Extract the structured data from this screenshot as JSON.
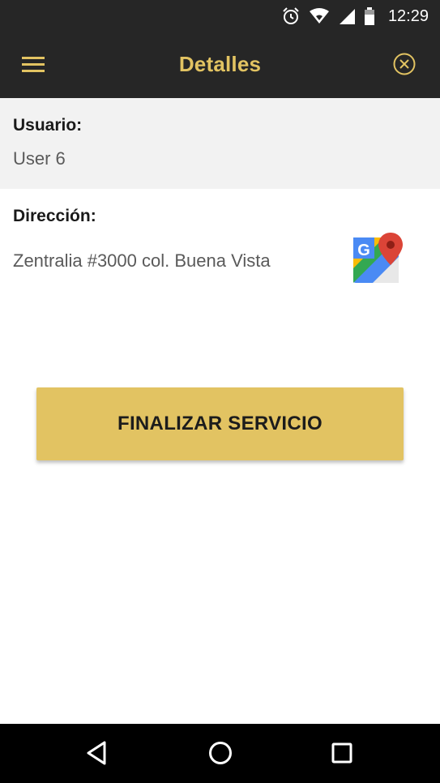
{
  "status_bar": {
    "time": "12:29",
    "icons": [
      "alarm-icon",
      "wifi-icon",
      "cell-signal-icon",
      "battery-icon"
    ]
  },
  "app_bar": {
    "title": "Detalles",
    "menu_icon": "hamburger-menu-icon",
    "close_icon": "close-circle-icon"
  },
  "user": {
    "label": "Usuario:",
    "value": "User 6"
  },
  "address": {
    "label": "Dirección:",
    "value": "Zentralia #3000 col. Buena Vista",
    "map_icon": "google-maps-icon"
  },
  "actions": {
    "finish_label": "FINALIZAR SERVICIO"
  },
  "nav_bar": {
    "icons": [
      "back-icon",
      "home-icon",
      "recents-icon"
    ]
  },
  "colors": {
    "accent": "#e2c362",
    "app_bar": "#262626",
    "section_bg": "#f2f2f2",
    "nav_bar": "#000000"
  }
}
